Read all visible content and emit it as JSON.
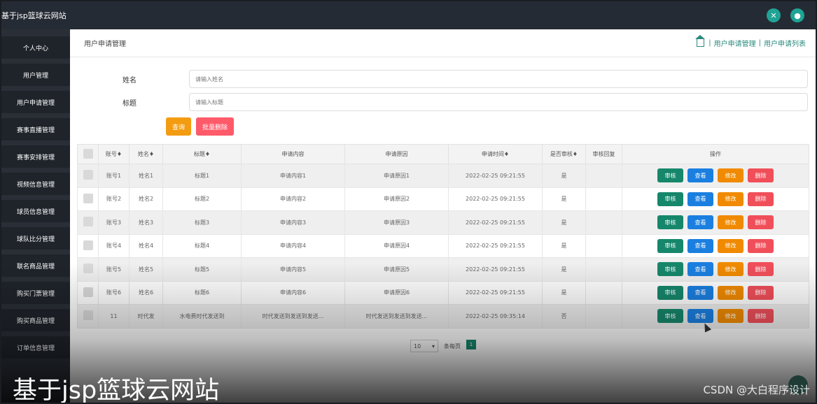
{
  "app": {
    "title": "基于jsp篮球云网站"
  },
  "topbar": {
    "icons": [
      "expand-icon",
      "user-icon"
    ]
  },
  "sidebar": {
    "items": [
      {
        "label": "个人中心"
      },
      {
        "label": "用户管理"
      },
      {
        "label": "用户申请管理"
      },
      {
        "label": "赛事直播管理"
      },
      {
        "label": "赛事安排管理"
      },
      {
        "label": "视频信息管理"
      },
      {
        "label": "球员信息管理"
      },
      {
        "label": "球队比分管理"
      },
      {
        "label": "联名商品管理"
      },
      {
        "label": "购买门票管理"
      },
      {
        "label": "购买商品管理"
      },
      {
        "label": "订单信息管理"
      }
    ]
  },
  "page": {
    "title": "用户申请管理",
    "breadcrumb": [
      "用户申请管理",
      "用户申请列表"
    ]
  },
  "search": {
    "name_label": "姓名",
    "name_placeholder": "请输入姓名",
    "title_label": "标题",
    "title_placeholder": "请输入标题",
    "query_button": "查询",
    "batch_delete_button": "批量删除"
  },
  "table": {
    "headers": [
      "",
      "账号♦",
      "姓名♦",
      "标题♦",
      "申请内容",
      "申请原因",
      "申请时间♦",
      "是否审核♦",
      "审核回复",
      "操作"
    ],
    "rows": [
      [
        "账号1",
        "姓名1",
        "标题1",
        "申请内容1",
        "申请原因1",
        "2022-02-25 09:21:55",
        "是",
        ""
      ],
      [
        "账号2",
        "姓名2",
        "标题2",
        "申请内容2",
        "申请原因2",
        "2022-02-25 09:21:55",
        "是",
        ""
      ],
      [
        "账号3",
        "姓名3",
        "标题3",
        "申请内容3",
        "申请原因3",
        "2022-02-25 09:21:55",
        "是",
        ""
      ],
      [
        "账号4",
        "姓名4",
        "标题4",
        "申请内容4",
        "申请原因4",
        "2022-02-25 09:21:55",
        "是",
        ""
      ],
      [
        "账号5",
        "姓名5",
        "标题5",
        "申请内容5",
        "申请原因5",
        "2022-02-25 09:21:55",
        "是",
        ""
      ],
      [
        "账号6",
        "姓名6",
        "标题6",
        "申请内容6",
        "申请原因6",
        "2022-02-25 09:21:55",
        "是",
        ""
      ],
      [
        "11",
        "时代发",
        "水电费时代发送到",
        "时代发送到发送到发送...",
        "时代发送到发送到发送...",
        "2022-02-25 09:35:14",
        "否",
        ""
      ]
    ],
    "actions": [
      "审核",
      "查看",
      "修改",
      "删除"
    ]
  },
  "pagination": {
    "page_size": "10",
    "page_size_label": "条每页",
    "current_page": "1"
  },
  "overlay": {
    "caption": "基于jsp篮球云网站",
    "watermark": "CSDN @大白程序设计"
  }
}
